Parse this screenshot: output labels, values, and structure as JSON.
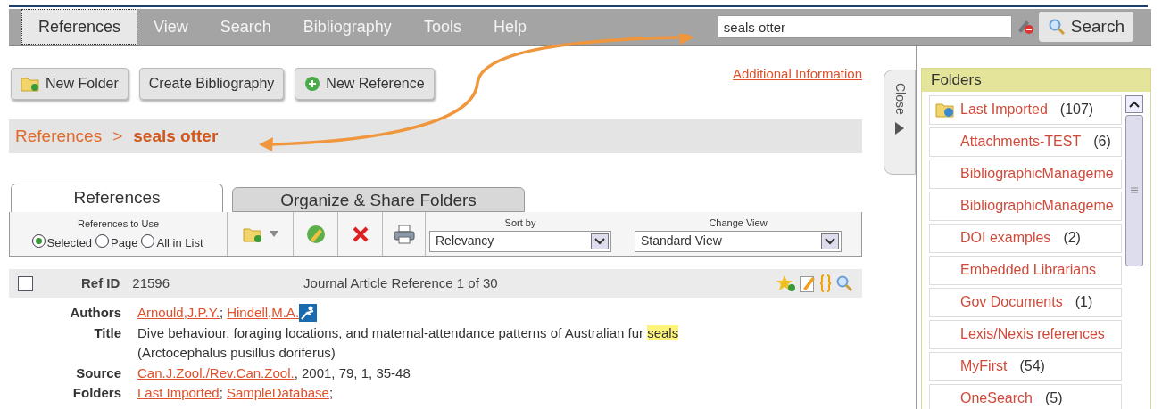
{
  "menu": [
    {
      "label": "References",
      "selected": true
    },
    {
      "label": "View",
      "selected": false
    },
    {
      "label": "Search",
      "selected": false
    },
    {
      "label": "Bibliography",
      "selected": false
    },
    {
      "label": "Tools",
      "selected": false
    },
    {
      "label": "Help",
      "selected": false
    }
  ],
  "search": {
    "value": "seals otter",
    "button": "Search"
  },
  "toolbar_buttons": [
    {
      "label": "New Folder",
      "kind": "folder"
    },
    {
      "label": "Create Bibliography",
      "kind": "plain"
    },
    {
      "label": "New Reference",
      "kind": "add"
    }
  ],
  "additional_link": "Additional Information",
  "breadcrumb": {
    "root": "References",
    "separator": ">",
    "current": "seals otter"
  },
  "tabs": [
    {
      "label": "References",
      "selected": true
    },
    {
      "label": "Organize & Share Folders",
      "selected": false
    }
  ],
  "references_to_use": {
    "label": "References to Use",
    "options": [
      {
        "label": "Selected",
        "selected": true
      },
      {
        "label": "Page",
        "selected": false
      },
      {
        "label": "All in List",
        "selected": false
      }
    ]
  },
  "sort_by": {
    "label": "Sort by",
    "value": "Relevancy"
  },
  "change_view": {
    "label": "Change View",
    "value": "Standard View"
  },
  "reference": {
    "checked": false,
    "ref_id_label": "Ref ID",
    "ref_id": "21596",
    "type": "Journal Article Reference 1 of 30",
    "fields": [
      {
        "label": "Authors",
        "kind": "links",
        "items": [
          {
            "text": "Arnould,J.P.Y.",
            "after": ";"
          },
          {
            "text": "Hindell,M.A."
          }
        ]
      },
      {
        "label": "Title",
        "kind": "text",
        "segments": [
          {
            "text": "Dive behaviour, foraging locations, and maternal-attendance patterns of Australian fur ",
            "highlighted": false
          },
          {
            "text": "seals",
            "highlighted": true
          }
        ],
        "line2": "(Arctocephalus pusillus doriferus)"
      },
      {
        "label": "Source",
        "kind": "source",
        "link": "Can.J.Zool./Rev.Can.Zool.",
        "rest": ", 2001, 79, 1, 35-48"
      },
      {
        "label": "Folders",
        "kind": "links",
        "items": [
          {
            "text": "Last Imported",
            "after": ";"
          },
          {
            "text": "SampleDatabase",
            "after": ";"
          }
        ]
      }
    ]
  },
  "close_tab": "Close",
  "folders": {
    "title": "Folders",
    "items": [
      {
        "name": "Last Imported",
        "count": "(107)",
        "icon": true
      },
      {
        "name": "Attachments-TEST",
        "count": "(6)",
        "icon": false
      },
      {
        "name": "BibliographicManageme",
        "icon": false
      },
      {
        "name": "BibliographicManageme",
        "icon": false
      },
      {
        "name": "DOI examples",
        "count": "(2)",
        "icon": false
      },
      {
        "name": "Embedded Librarians",
        "icon": false
      },
      {
        "name": "Gov Documents",
        "count": "(1)",
        "icon": false
      },
      {
        "name": "Lexis/Nexis references",
        "icon": false
      },
      {
        "name": "MyFirst",
        "count": "(54)",
        "icon": false
      },
      {
        "name": "OneSearch",
        "count": "(5)",
        "icon": false
      }
    ]
  }
}
